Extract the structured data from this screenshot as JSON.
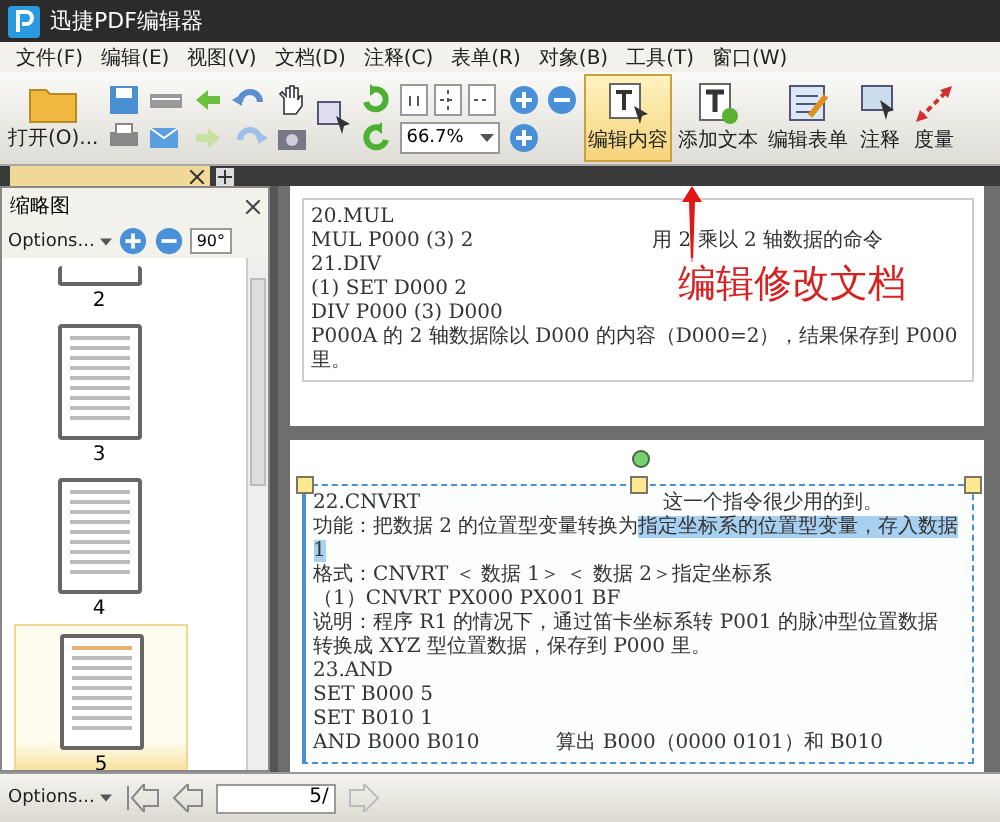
{
  "app": {
    "title": "迅捷PDF编辑器"
  },
  "menu": [
    {
      "label": "文件(F)"
    },
    {
      "label": "编辑(E)"
    },
    {
      "label": "视图(V)"
    },
    {
      "label": "文档(D)"
    },
    {
      "label": "注释(C)"
    },
    {
      "label": "表单(R)"
    },
    {
      "label": "对象(B)"
    },
    {
      "label": "工具(T)"
    },
    {
      "label": "窗口(W)"
    }
  ],
  "toolbar": {
    "open_label": "打开(O)...",
    "zoom": "66.7%",
    "tools": [
      {
        "label": "编辑内容",
        "kind": "edit",
        "selected": true
      },
      {
        "label": "添加文本",
        "kind": "text",
        "selected": false
      },
      {
        "label": "编辑表单",
        "kind": "form",
        "selected": false
      },
      {
        "label": "注释",
        "kind": "comment",
        "selected": false
      },
      {
        "label": "度量",
        "kind": "measure",
        "selected": false
      }
    ]
  },
  "thumbnail_panel": {
    "title": "缩略图",
    "options": "Options...",
    "rotate": "90°",
    "pages": [
      {
        "label": "2",
        "selected": false
      },
      {
        "label": "3",
        "selected": false
      },
      {
        "label": "4",
        "selected": false
      },
      {
        "label": "5",
        "selected": true
      }
    ]
  },
  "document": {
    "pages": [
      {
        "selected": false,
        "lines": [
          {
            "text": "20.MUL"
          },
          {
            "text": "MUL P000 (3) 2",
            "right": "用 2 乘以 2 轴数据的命令"
          },
          {
            "text": "21.DIV"
          },
          {
            "text": "(1) SET D000 2"
          },
          {
            "text": "DIV P000 (3) D000"
          },
          {
            "text": "P000A 的 2 轴数据除以 D000 的内容（D000=2），结果保存到 P000 里。"
          }
        ]
      },
      {
        "selected": true,
        "lines": [
          {
            "text": "22.CNVRT",
            "right": "这一个指令很少用的到。"
          },
          {
            "text": "功能：把数据 2 的位置型变量转换为",
            "highlight": "指定坐标系的位置型变量，存入数据 1"
          },
          {
            "text": "格式：CNVRT ＜ 数据 1＞ ＜ 数据 2＞指定坐标系"
          },
          {
            "text": "（1）CNVRT PX000 PX001 BF"
          },
          {
            "text": "说明：程序 R1 的情况下，通过笛卡坐标系转 P001 的脉冲型位置数据"
          },
          {
            "text": "转换成 XYZ 型位置数据，保存到 P000 里。"
          },
          {
            "text": "23.AND"
          },
          {
            "text": "SET B000 5"
          },
          {
            "text": "SET B010 1"
          },
          {
            "text": "AND B000 B010",
            "right": "算出 B000（0000 0101）和 B010"
          }
        ]
      }
    ]
  },
  "annotation": {
    "text": "编辑修改文档"
  },
  "bottom_bar": {
    "options": "Options...",
    "page": "5/"
  }
}
